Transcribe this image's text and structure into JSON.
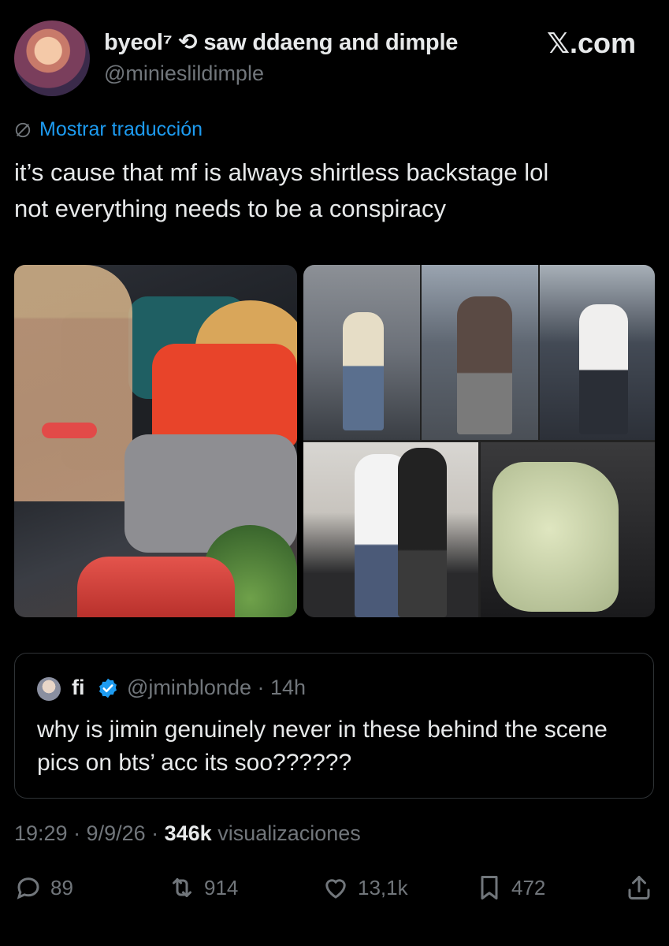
{
  "tweet": {
    "display_name": "byeol⁷ ⟲ saw ddaeng and dimple",
    "handle": "@minieslildimple",
    "site_label": "𝕏.com",
    "translate_label": "Mostrar traducción",
    "text_line1": "it’s cause that mf is always shirtless backstage lol",
    "text_line2": "not everything needs to be a conspiracy",
    "images": [
      {
        "icon": "photo-left"
      },
      {
        "icon": "collage-right"
      }
    ]
  },
  "quoted": {
    "name": "fi",
    "verified": true,
    "handle_time": "@jminblonde · 14h",
    "text": "why is jimin genuinely never in these behind the scene pics on bts’ acc its soo??????"
  },
  "meta": {
    "time": "19:29 · 9/9/26 · ",
    "views_count": "346k",
    "views_label": " visualizaciones"
  },
  "actions": {
    "replies": "89",
    "reposts": "914",
    "likes": "13,1k",
    "bookmarks": "472"
  },
  "colors": {
    "background": "#000000",
    "text": "#e7e9ea",
    "muted": "#71767b",
    "accent": "#1d9bf0"
  }
}
